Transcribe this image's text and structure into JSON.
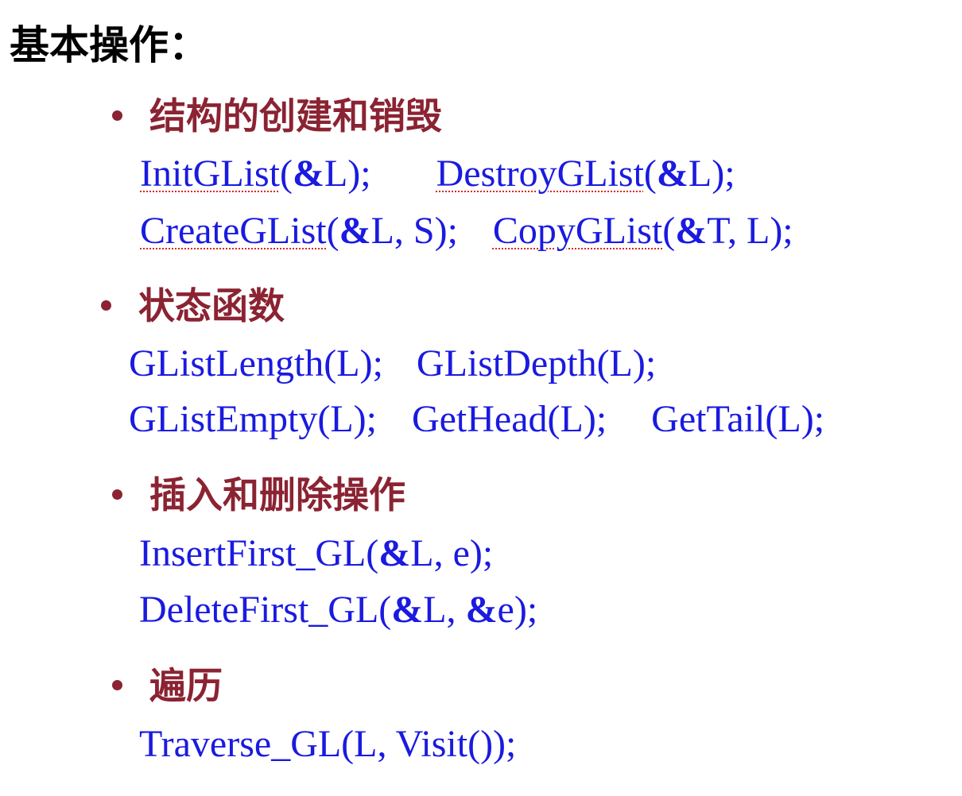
{
  "title": "基本操作：",
  "sections": [
    {
      "heading": "结构的创建和销毁",
      "lines": [
        [
          "InitGList",
          "(",
          "&",
          "L);",
          "DestroyGList",
          "(",
          "&",
          "L);"
        ],
        [
          "CreateGList",
          "(",
          "&",
          "L, S);",
          "CopyGList",
          "(",
          "&",
          "T, L);"
        ]
      ]
    },
    {
      "heading": "状态函数",
      "lines": [
        [
          "GListLength(L);",
          "GListDepth(L);"
        ],
        [
          "GListEmpty(L);",
          "GetHead(L);",
          "GetTail(L);"
        ]
      ]
    },
    {
      "heading": "插入和删除操作",
      "lines": [
        [
          "InsertFirst_GL(",
          "&",
          "L, e);"
        ],
        [
          "DeleteFirst_GL(",
          "&",
          "L, ",
          "&",
          "e);"
        ]
      ]
    },
    {
      "heading": "遍历",
      "lines": [
        [
          "Traverse_GL(L, Visit());"
        ]
      ]
    }
  ]
}
